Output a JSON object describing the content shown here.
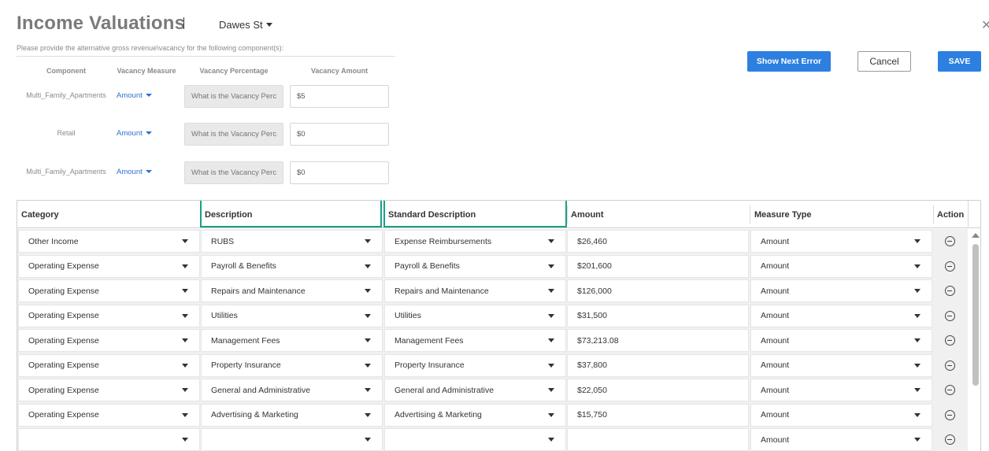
{
  "header": {
    "title": "Income Valuations",
    "property": "Dawes St",
    "close_icon": "close-icon"
  },
  "vacancy": {
    "instruction": "Please provide the alternative gross revenue\\vacancy for the following component(s):",
    "columns": [
      "Component",
      "Vacancy Measure",
      "Vacancy Percentage",
      "Vacancy Amount"
    ],
    "rows": [
      {
        "component": "Multi_Family_Apartments",
        "measure": "Amount",
        "pct_placeholder": "What is the Vacancy Percentage",
        "amount": "$5"
      },
      {
        "component": "Retail",
        "measure": "Amount",
        "pct_placeholder": "What is the Vacancy Percentage",
        "amount": "$0"
      },
      {
        "component": "Multi_Family_Apartments",
        "measure": "Amount",
        "pct_placeholder": "What is the Vacancy Percentage",
        "amount": "$0"
      }
    ]
  },
  "toolbar": {
    "next_error_label": "Show Next Error",
    "cancel_label": "Cancel",
    "save_label": "SAVE"
  },
  "grid": {
    "columns": [
      "Category",
      "Description",
      "Standard Description",
      "Amount",
      "Measure Type",
      "Action"
    ],
    "highlight_color": "#1aa086",
    "rows": [
      {
        "category": "Other Income",
        "description": "RUBS",
        "standard": "Expense Reimbursements",
        "amount": "$26,460",
        "measure": "Amount"
      },
      {
        "category": "Operating Expense",
        "description": "Payroll & Benefits",
        "standard": "Payroll & Benefits",
        "amount": "$201,600",
        "measure": "Amount"
      },
      {
        "category": "Operating Expense",
        "description": "Repairs and Maintenance",
        "standard": "Repairs and Maintenance",
        "amount": "$126,000",
        "measure": "Amount"
      },
      {
        "category": "Operating Expense",
        "description": "Utilities",
        "standard": "Utilities",
        "amount": "$31,500",
        "measure": "Amount"
      },
      {
        "category": "Operating Expense",
        "description": "Management Fees",
        "standard": "Management Fees",
        "amount": "$73,213.08",
        "measure": "Amount"
      },
      {
        "category": "Operating Expense",
        "description": "Property Insurance",
        "standard": "Property Insurance",
        "amount": "$37,800",
        "measure": "Amount"
      },
      {
        "category": "Operating Expense",
        "description": "General and Administrative",
        "standard": "General and Administrative",
        "amount": "$22,050",
        "measure": "Amount"
      },
      {
        "category": "Operating Expense",
        "description": "Advertising & Marketing",
        "standard": "Advertising & Marketing",
        "amount": "$15,750",
        "measure": "Amount"
      },
      {
        "category": "",
        "description": "",
        "standard": "",
        "amount": "",
        "measure": "Amount"
      }
    ]
  }
}
